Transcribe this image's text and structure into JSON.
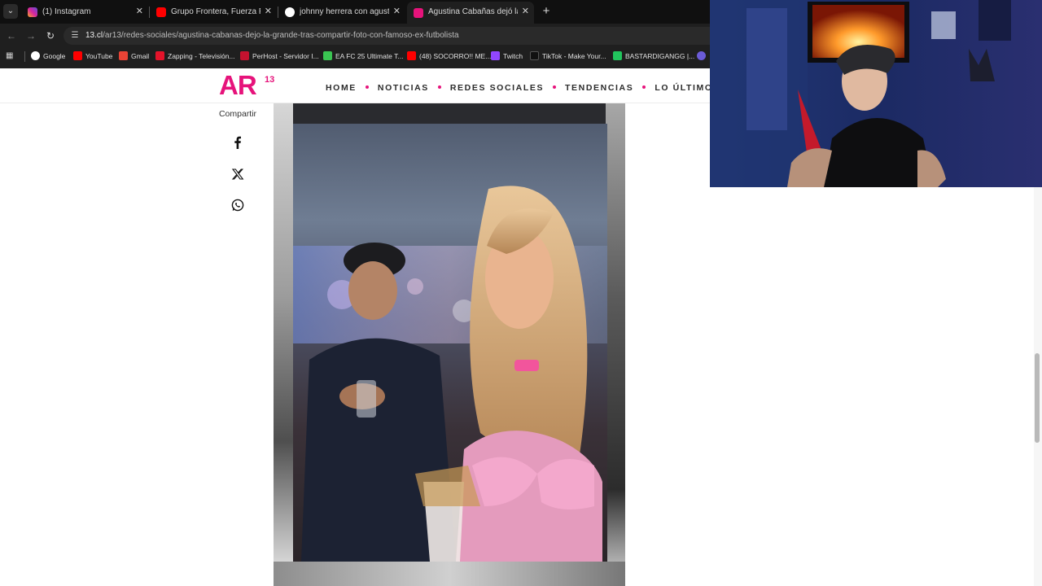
{
  "browser": {
    "tabs": [
      {
        "title": "(1) Instagram",
        "active": false,
        "favicon_color": "#d6249f"
      },
      {
        "title": "Grupo Frontera, Fuerza Regida,",
        "active": false,
        "favicon_color": "#ff0000"
      },
      {
        "title": "johnny herrera con agustina - B",
        "active": false,
        "favicon_color": "#ffffff"
      },
      {
        "title": "Agustina Cabañas dejó la grand",
        "active": true,
        "favicon_color": "#e6137b"
      }
    ],
    "new_tab_label": "+",
    "url_host": "13.cl",
    "url_path": "/ar13/redes-sociales/agustina-cabanas-dejo-la-grande-tras-compartir-foto-con-famoso-ex-futbolista",
    "bookmarks": [
      {
        "label": "Google",
        "color": "#4285f4"
      },
      {
        "label": "YouTube",
        "color": "#ff0000"
      },
      {
        "label": "Gmail",
        "color": "#ea4335"
      },
      {
        "label": "Zapping - Televisión...",
        "color": "#e4132a"
      },
      {
        "label": "PerHost - Servidor I...",
        "color": "#c4122f"
      },
      {
        "label": "EA FC 25 Ultimate T...",
        "color": "#3ac452"
      },
      {
        "label": "(48) SOCORRO!! ME...",
        "color": "#ff0000"
      },
      {
        "label": "Twitch",
        "color": "#9146ff"
      },
      {
        "label": "TikTok - Make Your...",
        "color": "#111111"
      },
      {
        "label": "BASTARDIGANGG |...",
        "color": "#21c55d"
      }
    ]
  },
  "site": {
    "logo_text": "AR",
    "logo_sup": "13",
    "brand_color": "#e6137b",
    "nav": [
      "HOME",
      "NOTICIAS",
      "REDES SOCIALES",
      "TENDENCIAS",
      "LO ÚLTIMO"
    ]
  },
  "share": {
    "label": "Compartir",
    "icons": [
      "facebook-icon",
      "x-icon",
      "whatsapp-icon"
    ]
  },
  "article": {
    "image_icon": "photo"
  }
}
